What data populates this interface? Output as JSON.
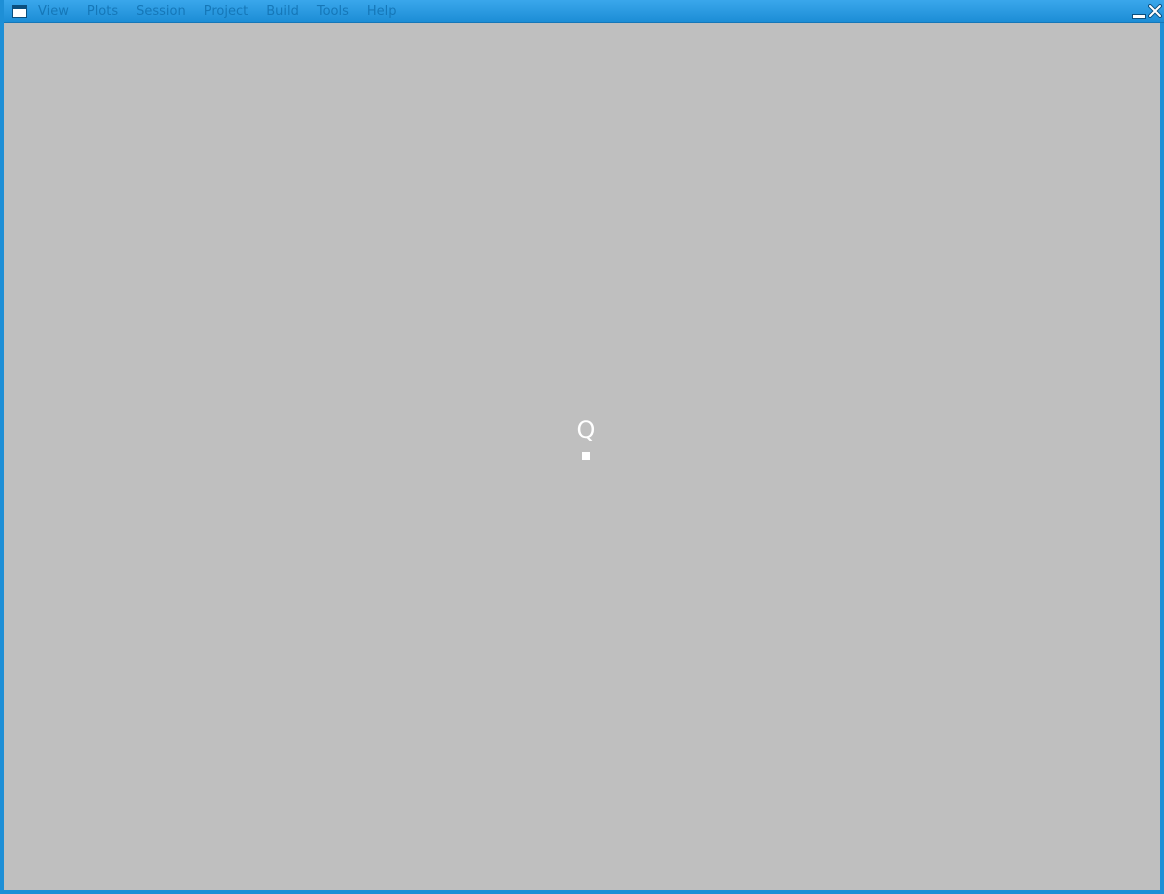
{
  "titlebar": {
    "menu": [
      "View",
      "Plots",
      "Session",
      "Project",
      "Build",
      "Tools",
      "Help"
    ],
    "icons": {
      "app": "window-icon",
      "minimize": "minimize-icon",
      "close": "close-icon"
    }
  },
  "loading": {
    "glyph": "Q"
  },
  "colors": {
    "titlebar": "#1e8fd6",
    "menu_text": "#1577b8",
    "content_bg": "#bfbfbf",
    "loader": "#ffffff"
  }
}
